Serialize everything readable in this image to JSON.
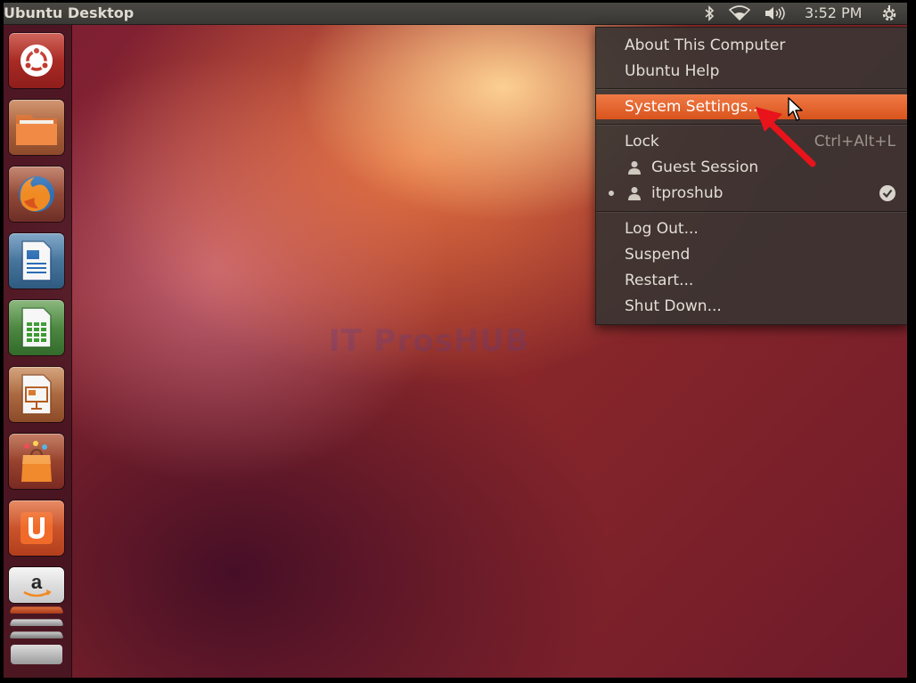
{
  "panel": {
    "title": "Ubuntu Desktop",
    "clock": "3:52 PM",
    "icons": [
      "bluetooth-icon",
      "wifi-icon",
      "volume-icon",
      "session-gear-icon"
    ]
  },
  "launcher": {
    "items": [
      {
        "name": "dash-home",
        "icon": "ubuntu-logo-icon"
      },
      {
        "name": "files",
        "icon": "folder-icon"
      },
      {
        "name": "firefox",
        "icon": "firefox-icon"
      },
      {
        "name": "libreoffice-writer",
        "icon": "writer-document-icon"
      },
      {
        "name": "libreoffice-calc",
        "icon": "calc-spreadsheet-icon"
      },
      {
        "name": "libreoffice-impress",
        "icon": "impress-presentation-icon"
      },
      {
        "name": "software-center",
        "icon": "shopping-bag-icon"
      },
      {
        "name": "ubuntu-one",
        "icon": "ubuntu-one-icon"
      },
      {
        "name": "amazon",
        "icon": "amazon-icon"
      }
    ]
  },
  "session_menu": {
    "about": "About This Computer",
    "help": "Ubuntu Help",
    "settings": "System Settings...",
    "lock": "Lock",
    "lock_shortcut": "Ctrl+Alt+L",
    "guest": "Guest Session",
    "user": "itproshub",
    "logout": "Log Out...",
    "suspend": "Suspend",
    "restart": "Restart...",
    "shutdown": "Shut Down..."
  },
  "watermark": "IT ProsHUB",
  "colors": {
    "highlight": "#e8652c",
    "arrow": "#e8131b",
    "panel": "#3f3d3a"
  }
}
